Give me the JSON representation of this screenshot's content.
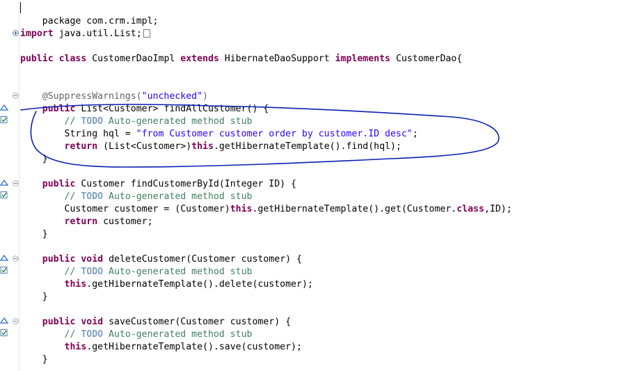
{
  "editor": {
    "lines": {
      "l1": [
        "package com.crm.impl;"
      ],
      "l2": [
        "import",
        " java.util.List;"
      ],
      "l3": [
        "public",
        " ",
        "class",
        " CustomerDaoImpl ",
        "extends",
        " HibernateDaoSupport ",
        "implements",
        " CustomerDao{"
      ],
      "l4": [
        "    @SuppressWarnings(",
        "\"unchecked\"",
        ")"
      ],
      "l5": [
        "    ",
        "public",
        " List<Customer> findAllCustomer() {"
      ],
      "l6": [
        "        // ",
        "TODO",
        " Auto-generated method stub"
      ],
      "l7": [
        "        String hql = ",
        "\"from Customer customer order by customer.ID desc\"",
        ";"
      ],
      "l8": [
        "        ",
        "return",
        " (List<Customer>)",
        "this",
        ".getHibernateTemplate().find(hql);"
      ],
      "l9": [
        "    }"
      ],
      "l10": [
        "    ",
        "public",
        " Customer findCustomerById(Integer ID) {"
      ],
      "l11": [
        "        // ",
        "TODO",
        " Auto-generated method stub"
      ],
      "l12": [
        "        Customer customer = (Customer)",
        "this",
        ".getHibernateTemplate().get(Customer.",
        "class",
        ",ID);"
      ],
      "l13": [
        "        ",
        "return",
        " customer;"
      ],
      "l14": [
        "    }"
      ],
      "l15": [
        "    ",
        "public",
        " ",
        "void",
        " deleteCustomer(Customer customer) {"
      ],
      "l16": [
        "        // ",
        "TODO",
        " Auto-generated method stub"
      ],
      "l17": [
        "        ",
        "this",
        ".getHibernateTemplate().delete(customer);"
      ],
      "l18": [
        "    }"
      ],
      "l19": [
        "    ",
        "public",
        " ",
        "void",
        " saveCustomer(Customer customer) {"
      ],
      "l20": [
        "        // ",
        "TODO",
        " Auto-generated method stub"
      ],
      "l21": [
        "        ",
        "this",
        ".getHibernateTemplate().save(customer);"
      ],
      "l22": [
        "    }"
      ]
    }
  },
  "colors": {
    "keyword": "#7f0055",
    "string": "#2a00ff",
    "comment": "#3f7f5f",
    "todo": "#7f9fbf",
    "annotation": "#646464",
    "scribble": "#0a1fb4"
  }
}
